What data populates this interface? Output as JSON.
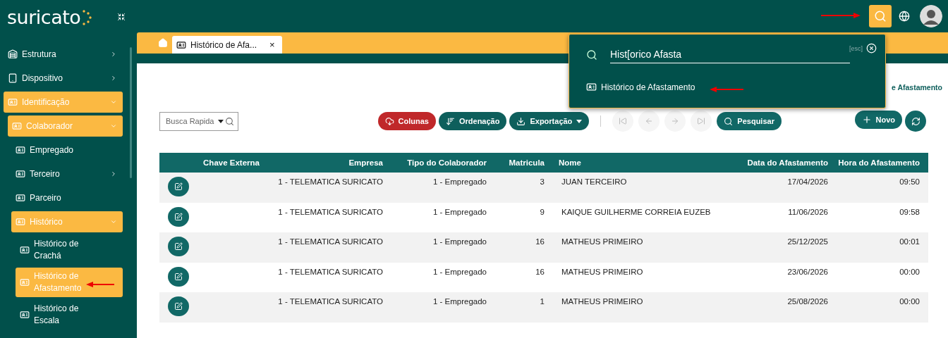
{
  "logo": "suricato",
  "header": {
    "search_button": {
      "selected": true
    }
  },
  "tabs": [
    {
      "label": "Histórico de Afa...",
      "selected": true,
      "close": "×"
    }
  ],
  "sidebar": {
    "items": [
      {
        "label": "Estrutura",
        "expanded": false
      },
      {
        "label": "Dispositivo",
        "expanded": false
      },
      {
        "label": "Identificação",
        "expanded": true,
        "children": [
          {
            "label": "Colaborador",
            "expanded": true,
            "children": [
              {
                "label": "Empregado",
                "selected": false
              },
              {
                "label": "Terceiro",
                "expanded": false
              },
              {
                "label": "Parceiro",
                "selected": false
              },
              {
                "label": "Histórico",
                "expanded": true,
                "children": [
                  {
                    "label": "Histórico de Crachá",
                    "selected": false
                  },
                  {
                    "label": "Histórico de Afastamento",
                    "selected": true
                  },
                  {
                    "label": "Histórico de Escala",
                    "selected": false
                  }
                ]
              }
            ]
          }
        ]
      }
    ]
  },
  "page_title": "e Afastamento",
  "toolbar": {
    "quick_search": {
      "placeholder": "Busca Rapida"
    },
    "buttons": [
      {
        "label": "Colunas",
        "kind": "columns"
      },
      {
        "label": "Ordenação",
        "kind": "sort"
      },
      {
        "label": "Exportação",
        "kind": "export"
      }
    ],
    "pager": [
      {
        "kind": "first",
        "disabled": true
      },
      {
        "kind": "prev",
        "disabled": true
      },
      {
        "kind": "next",
        "disabled": true
      },
      {
        "kind": "last",
        "disabled": true
      }
    ],
    "search_button": "Pesquisar",
    "new_button": "Novo"
  },
  "table": {
    "columns": [
      {
        "label": "Chave Externa"
      },
      {
        "label": "Empresa"
      },
      {
        "label": "Tipo do Colaborador"
      },
      {
        "label": "Matricula"
      },
      {
        "label": "Nome"
      },
      {
        "label": "Data do Afastamento"
      },
      {
        "label": "Hora do Afastamento"
      }
    ],
    "rows": [
      {
        "cells": [
          "",
          "1 - TELEMATICA SURICATO",
          "1 - Empregado",
          "3",
          "JUAN TERCEIRO",
          "17/04/2026",
          "09:50"
        ]
      },
      {
        "cells": [
          "",
          "1 - TELEMATICA SURICATO",
          "1 - Empregado",
          "9",
          "KAIQUE GUILHERME CORREIA EUZEB",
          "11/06/2026",
          "09:58"
        ]
      },
      {
        "cells": [
          "",
          "1 - TELEMATICA SURICATO",
          "1 - Empregado",
          "16",
          "MATHEUS PRIMEIRO",
          "25/12/2025",
          "00:01"
        ]
      },
      {
        "cells": [
          "",
          "1 - TELEMATICA SURICATO",
          "1 - Empregado",
          "16",
          "MATHEUS PRIMEIRO",
          "23/06/2026",
          "00:00"
        ]
      },
      {
        "cells": [
          "",
          "1 - TELEMATICA SURICATO",
          "1 - Empregado",
          "1",
          "MATHEUS PRIMEIRO",
          "25/08/2026",
          "00:00"
        ]
      }
    ]
  },
  "search_overlay": {
    "value": "Hist[orico Afasta",
    "hint": "[esc]",
    "results": [
      {
        "label": "Histórico de Afastamento"
      }
    ]
  }
}
